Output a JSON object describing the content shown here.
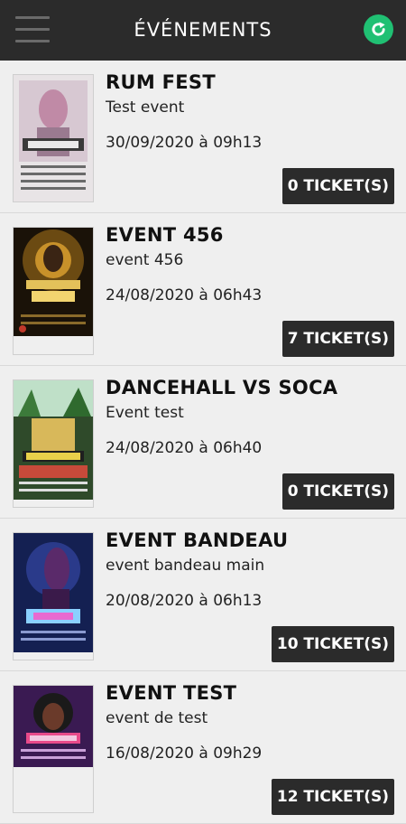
{
  "header": {
    "title": "ÉVÉNEMENTS",
    "menu_icon": "hamburger-menu-icon",
    "refresh_icon": "refresh-icon",
    "refresh_color": "#20c073"
  },
  "events": [
    {
      "title": "RUM FEST",
      "subtitle": "Test event",
      "date": "30/09/2020 à 09h13",
      "tickets": "0 TICKET(S)"
    },
    {
      "title": "EVENT 456",
      "subtitle": "event 456",
      "date": "24/08/2020 à 06h43",
      "tickets": "7 TICKET(S)"
    },
    {
      "title": "DANCEHALL VS SOCA",
      "subtitle": "Event test",
      "date": "24/08/2020 à 06h40",
      "tickets": "0 TICKET(S)"
    },
    {
      "title": "EVENT BANDEAU",
      "subtitle": "event bandeau main",
      "date": "20/08/2020 à 06h13",
      "tickets": "10 TICKET(S)"
    },
    {
      "title": "EVENT TEST",
      "subtitle": "event de test",
      "date": "16/08/2020 à 09h29",
      "tickets": "12 TICKET(S)"
    }
  ]
}
